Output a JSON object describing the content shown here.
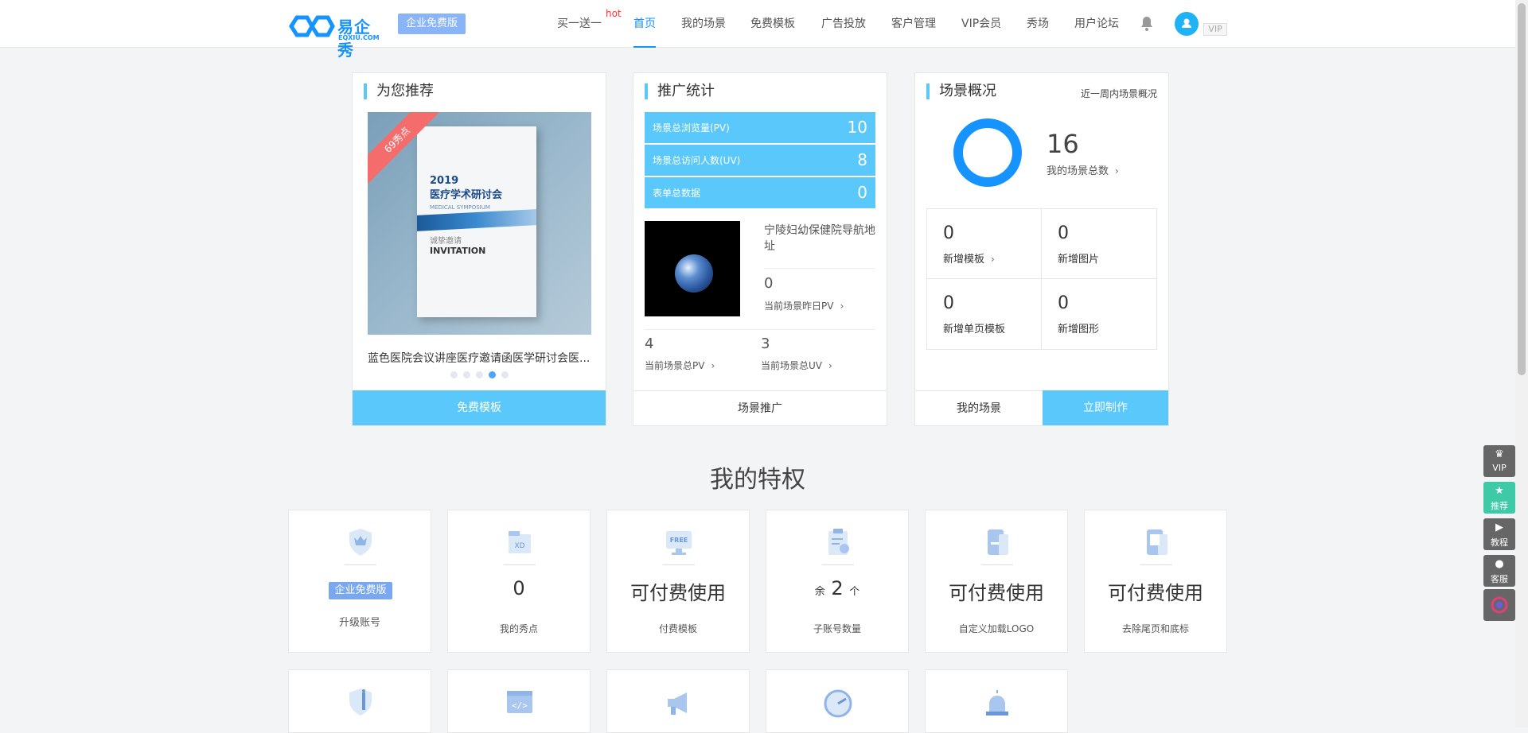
{
  "header": {
    "logo_cn": "易企秀",
    "logo_en": "EQXIU.COM",
    "edition": "企业免费版",
    "hot_tag": "hot",
    "nav": [
      "买一送一",
      "首页",
      "我的场景",
      "免费模板",
      "广告投放",
      "客户管理",
      "VIP会员",
      "秀场",
      "用户论坛"
    ],
    "active_nav": "首页",
    "vip": "VIP"
  },
  "recommend": {
    "title": "为您推荐",
    "ribbon": "69秀点",
    "booklet_year": "2019",
    "booklet_title": "医疗学术研讨会",
    "booklet_en": "MEDICAL SYMPOSIUM",
    "booklet_invite_cn": "诚挚邀请",
    "booklet_invite_en": "INVITATION",
    "caption": "蓝色医院会议讲座医疗邀请函医学研讨会医...",
    "active_dot": 4,
    "button": "免费模板"
  },
  "promo": {
    "title": "推广统计",
    "rows": [
      {
        "label": "场景总浏览量(PV)",
        "value": "10"
      },
      {
        "label": "场景总访问人数(UV)",
        "value": "8"
      },
      {
        "label": "表单总数据",
        "value": "0"
      }
    ],
    "scene_title": "宁陵妇幼保健院导航地址",
    "yesterday_pv": "0",
    "yesterday_pv_label": "当前场景昨日PV",
    "total_pv": "4",
    "total_pv_label": "当前场景总PV",
    "total_uv": "3",
    "total_uv_label": "当前场景总UV",
    "button": "场景推广"
  },
  "overview": {
    "title": "场景概况",
    "week_link": "近一周内场景概况",
    "total": "16",
    "total_label": "我的场景总数",
    "cells": [
      {
        "value": "0",
        "label": "新增模板",
        "arrow": true
      },
      {
        "value": "0",
        "label": "新增图片",
        "arrow": false
      },
      {
        "value": "0",
        "label": "新增单页模板",
        "arrow": false
      },
      {
        "value": "0",
        "label": "新增图形",
        "arrow": false
      }
    ],
    "btn_left": "我的场景",
    "btn_right": "立即制作"
  },
  "privileges": {
    "title": "我的特权",
    "items": [
      {
        "icon": "crown-shield-icon",
        "pill": "企业免费版",
        "label": "升级账号"
      },
      {
        "icon": "coin-icon",
        "value": "0",
        "label": "我的秀点"
      },
      {
        "icon": "free-monitor-icon",
        "value": "可付费使用",
        "label": "付费模板"
      },
      {
        "icon": "clipboard-icon",
        "prefix": "余",
        "value": "2",
        "suffix": "个",
        "label": "子账号数量"
      },
      {
        "icon": "phone-logo-icon",
        "value": "可付费使用",
        "label": "自定义加载LOGO"
      },
      {
        "icon": "phone-footer-icon",
        "value": "可付费使用",
        "label": "去除尾页和底标"
      }
    ],
    "row2_icons": [
      "info-shield-icon",
      "code-icon",
      "megaphone-icon",
      "speed-icon",
      "alarm-icon"
    ]
  },
  "sidebar": [
    {
      "icon": "crown-icon",
      "label": "VIP",
      "color": "#666666"
    },
    {
      "icon": "star-icon",
      "label": "推荐",
      "color": "#3ec9a7"
    },
    {
      "icon": "play-icon",
      "label": "教程",
      "color": "#666666"
    },
    {
      "icon": "user-icon",
      "label": "客服",
      "color": "#666666"
    },
    {
      "icon": "app-logo-icon",
      "label": "",
      "color": "#666666"
    }
  ],
  "colors": {
    "accent": "#1593ff",
    "light_blue": "#5ac8fa"
  }
}
